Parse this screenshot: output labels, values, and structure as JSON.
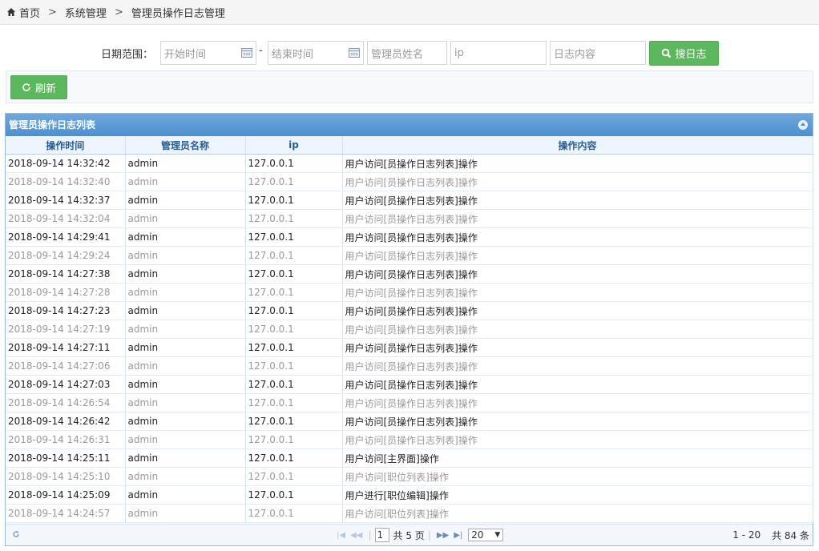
{
  "breadcrumb": {
    "home": "首页",
    "sep": ">",
    "level1": "系统管理",
    "level2": "管理员操作日志管理"
  },
  "search": {
    "date_label": "日期范围：",
    "start_placeholder": "开始时间",
    "dash": "-",
    "end_placeholder": "结束时间",
    "admin_placeholder": "管理员姓名",
    "ip_placeholder": "ip",
    "content_placeholder": "日志内容",
    "search_button": "搜日志"
  },
  "toolbar": {
    "refresh_button": "刷新"
  },
  "grid": {
    "title": "管理员操作日志列表",
    "columns": [
      "操作时间",
      "管理员名称",
      "ip",
      "操作内容"
    ],
    "rows": [
      [
        "2018-09-14 14:32:42",
        "admin",
        "127.0.0.1",
        "用户访问[员操作日志列表]操作"
      ],
      [
        "2018-09-14 14:32:40",
        "admin",
        "127.0.0.1",
        "用户访问[员操作日志列表]操作"
      ],
      [
        "2018-09-14 14:32:37",
        "admin",
        "127.0.0.1",
        "用户访问[员操作日志列表]操作"
      ],
      [
        "2018-09-14 14:32:04",
        "admin",
        "127.0.0.1",
        "用户访问[员操作日志列表]操作"
      ],
      [
        "2018-09-14 14:29:41",
        "admin",
        "127.0.0.1",
        "用户访问[员操作日志列表]操作"
      ],
      [
        "2018-09-14 14:29:24",
        "admin",
        "127.0.0.1",
        "用户访问[员操作日志列表]操作"
      ],
      [
        "2018-09-14 14:27:38",
        "admin",
        "127.0.0.1",
        "用户访问[员操作日志列表]操作"
      ],
      [
        "2018-09-14 14:27:28",
        "admin",
        "127.0.0.1",
        "用户访问[员操作日志列表]操作"
      ],
      [
        "2018-09-14 14:27:23",
        "admin",
        "127.0.0.1",
        "用户访问[员操作日志列表]操作"
      ],
      [
        "2018-09-14 14:27:19",
        "admin",
        "127.0.0.1",
        "用户访问[员操作日志列表]操作"
      ],
      [
        "2018-09-14 14:27:11",
        "admin",
        "127.0.0.1",
        "用户访问[员操作日志列表]操作"
      ],
      [
        "2018-09-14 14:27:06",
        "admin",
        "127.0.0.1",
        "用户访问[员操作日志列表]操作"
      ],
      [
        "2018-09-14 14:27:03",
        "admin",
        "127.0.0.1",
        "用户访问[员操作日志列表]操作"
      ],
      [
        "2018-09-14 14:26:54",
        "admin",
        "127.0.0.1",
        "用户访问[员操作日志列表]操作"
      ],
      [
        "2018-09-14 14:26:42",
        "admin",
        "127.0.0.1",
        "用户访问[员操作日志列表]操作"
      ],
      [
        "2018-09-14 14:26:31",
        "admin",
        "127.0.0.1",
        "用户访问[员操作日志列表]操作"
      ],
      [
        "2018-09-14 14:25:11",
        "admin",
        "127.0.0.1",
        "用户访问[主界面]操作"
      ],
      [
        "2018-09-14 14:25:10",
        "admin",
        "127.0.0.1",
        "用户访问[职位列表]操作"
      ],
      [
        "2018-09-14 14:25:09",
        "admin",
        "127.0.0.1",
        "用户进行[职位编辑]操作"
      ],
      [
        "2018-09-14 14:24:57",
        "admin",
        "127.0.0.1",
        "用户访问[职位列表]操作"
      ]
    ]
  },
  "pager": {
    "page": "1",
    "total_pages_text": "共 5 页",
    "page_size": "20",
    "range_text": "1 - 20",
    "total_text": "共 84 条"
  },
  "colors": {
    "accent_green": "#5cb85c",
    "grid_header_blue": "#4d8fd0"
  }
}
